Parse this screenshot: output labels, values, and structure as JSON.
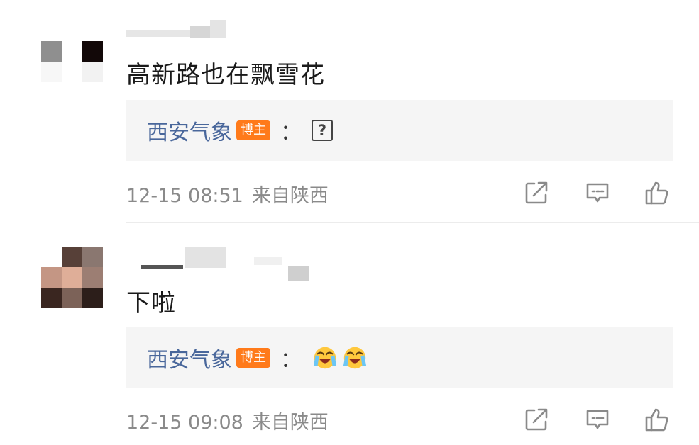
{
  "comments": [
    {
      "text": "高新路也在飘雪花",
      "reply": {
        "author": "西安气象",
        "badge": "博主",
        "colon": "：",
        "content_icon": "unknown-glyph-box",
        "content_glyph": "?"
      },
      "time": "12-15 08:51",
      "source": "来自陕西",
      "actions": [
        "share-icon",
        "comment-icon",
        "like-icon"
      ]
    },
    {
      "text": "下啦",
      "reply": {
        "author": "西安气象",
        "badge": "博主",
        "colon": "：",
        "content_icons": [
          "crying-laughing-emoji",
          "crying-laughing-emoji"
        ]
      },
      "time": "12-15 09:08",
      "source": "来自陕西",
      "actions": [
        "share-icon",
        "comment-icon",
        "like-icon"
      ]
    }
  ],
  "colors": {
    "author": "#49679b",
    "badge": "#ff7a1a",
    "reply_bg": "#f5f5f5",
    "meta": "#8a8a8a"
  }
}
